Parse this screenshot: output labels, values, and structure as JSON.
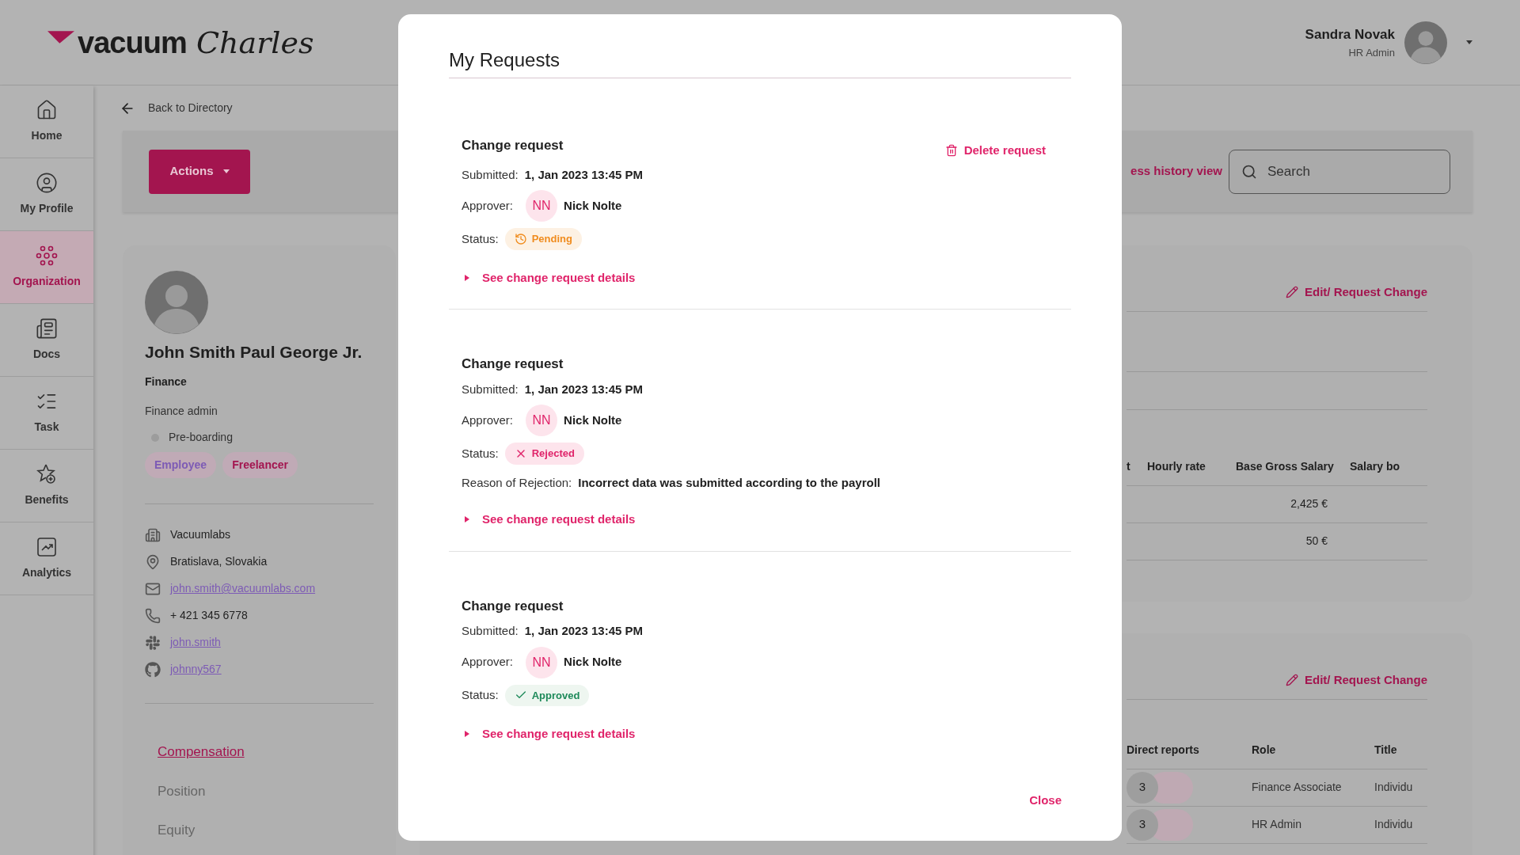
{
  "header": {
    "logo": {
      "word": "vacuum",
      "script": "Charles"
    },
    "user": {
      "name": "Sandra Novak",
      "role": "HR Admin"
    }
  },
  "sidebar": {
    "items": [
      {
        "kind": "home",
        "label": "Home",
        "selected": false
      },
      {
        "kind": "profile",
        "label": "My Profile",
        "selected": false
      },
      {
        "kind": "organization",
        "label": "Organization",
        "selected": true
      },
      {
        "kind": "docs",
        "label": "Docs",
        "selected": false
      },
      {
        "kind": "task",
        "label": "Task",
        "selected": false
      },
      {
        "kind": "benefits",
        "label": "Benefits",
        "selected": false
      },
      {
        "kind": "analytics",
        "label": "Analytics",
        "selected": false
      }
    ]
  },
  "back_link": "Back to Directory",
  "toolbar": {
    "actions_button": "Actions",
    "history_link": "ess history view",
    "search": {
      "placeholder": "Search"
    }
  },
  "profile": {
    "name": "John Smith Paul George Jr.",
    "department": "Finance",
    "position": "Finance admin",
    "status": "Pre-boarding",
    "tags": [
      {
        "label": "Employee",
        "color": "#7d5bb5"
      },
      {
        "label": "Freelancer",
        "color": "#a3154f"
      }
    ],
    "contacts": [
      {
        "kind": "company",
        "text": "Vacuumlabs"
      },
      {
        "kind": "location",
        "text": "Bratislava, Slovakia"
      },
      {
        "kind": "email",
        "text": "john.smith@vacuumlabs.com"
      },
      {
        "kind": "phone",
        "text": "+ 421 345 6778"
      },
      {
        "kind": "slack",
        "text": "john.smith"
      },
      {
        "kind": "github",
        "text": "johnny567"
      }
    ],
    "tabs": [
      {
        "label": "Compensation",
        "selected": true
      },
      {
        "label": "Position",
        "selected": false
      },
      {
        "label": "Equity",
        "selected": false
      }
    ]
  },
  "compensation_card": {
    "edit_link": "Edit/ Request Change",
    "columns": [
      "t",
      "Hourly rate",
      "Base Gross Salary",
      "Salary bo"
    ],
    "rows": [
      {
        "base_gross_salary": "2,425 €"
      },
      {
        "base_gross_salary": "50 €"
      }
    ]
  },
  "reports_card": {
    "edit_link": "Edit/ Request Change",
    "columns": [
      "Direct reports",
      "Role",
      "Title"
    ],
    "rows": [
      {
        "count": "3",
        "role": "Finance Associate",
        "title": "Individu"
      },
      {
        "count": "3",
        "role": "HR Admin",
        "title": "Individu"
      }
    ]
  },
  "modal": {
    "title": "My Requests",
    "close": "Close",
    "requests": [
      {
        "title": "Change request",
        "delete": "Delete request",
        "submitted_label": "Submitted:",
        "submitted": "1, Jan 2023 13:45 PM",
        "approver_label": "Approver:",
        "approver_initials": "NN",
        "approver": "Nick Nolte",
        "status_label": "Status:",
        "status": {
          "kind": "pending",
          "label": "Pending"
        },
        "details_link": "See change request details"
      },
      {
        "title": "Change request",
        "submitted_label": "Submitted:",
        "submitted": "1, Jan 2023 13:45 PM",
        "approver_label": "Approver:",
        "approver_initials": "NN",
        "approver": "Nick Nolte",
        "status_label": "Status:",
        "status": {
          "kind": "rejected",
          "label": "Rejected"
        },
        "rejection_label": "Reason of Rejection:",
        "rejection": "Incorrect data was submitted according to the payroll",
        "details_link": "See change request details"
      },
      {
        "title": "Change request",
        "submitted_label": "Submitted:",
        "submitted": "1, Jan 2023 13:45 PM",
        "approver_label": "Approver:",
        "approver_initials": "NN",
        "approver": "Nick Nolte",
        "status_label": "Status:",
        "status": {
          "kind": "approved",
          "label": "Approved"
        },
        "details_link": "See change request details"
      }
    ]
  }
}
